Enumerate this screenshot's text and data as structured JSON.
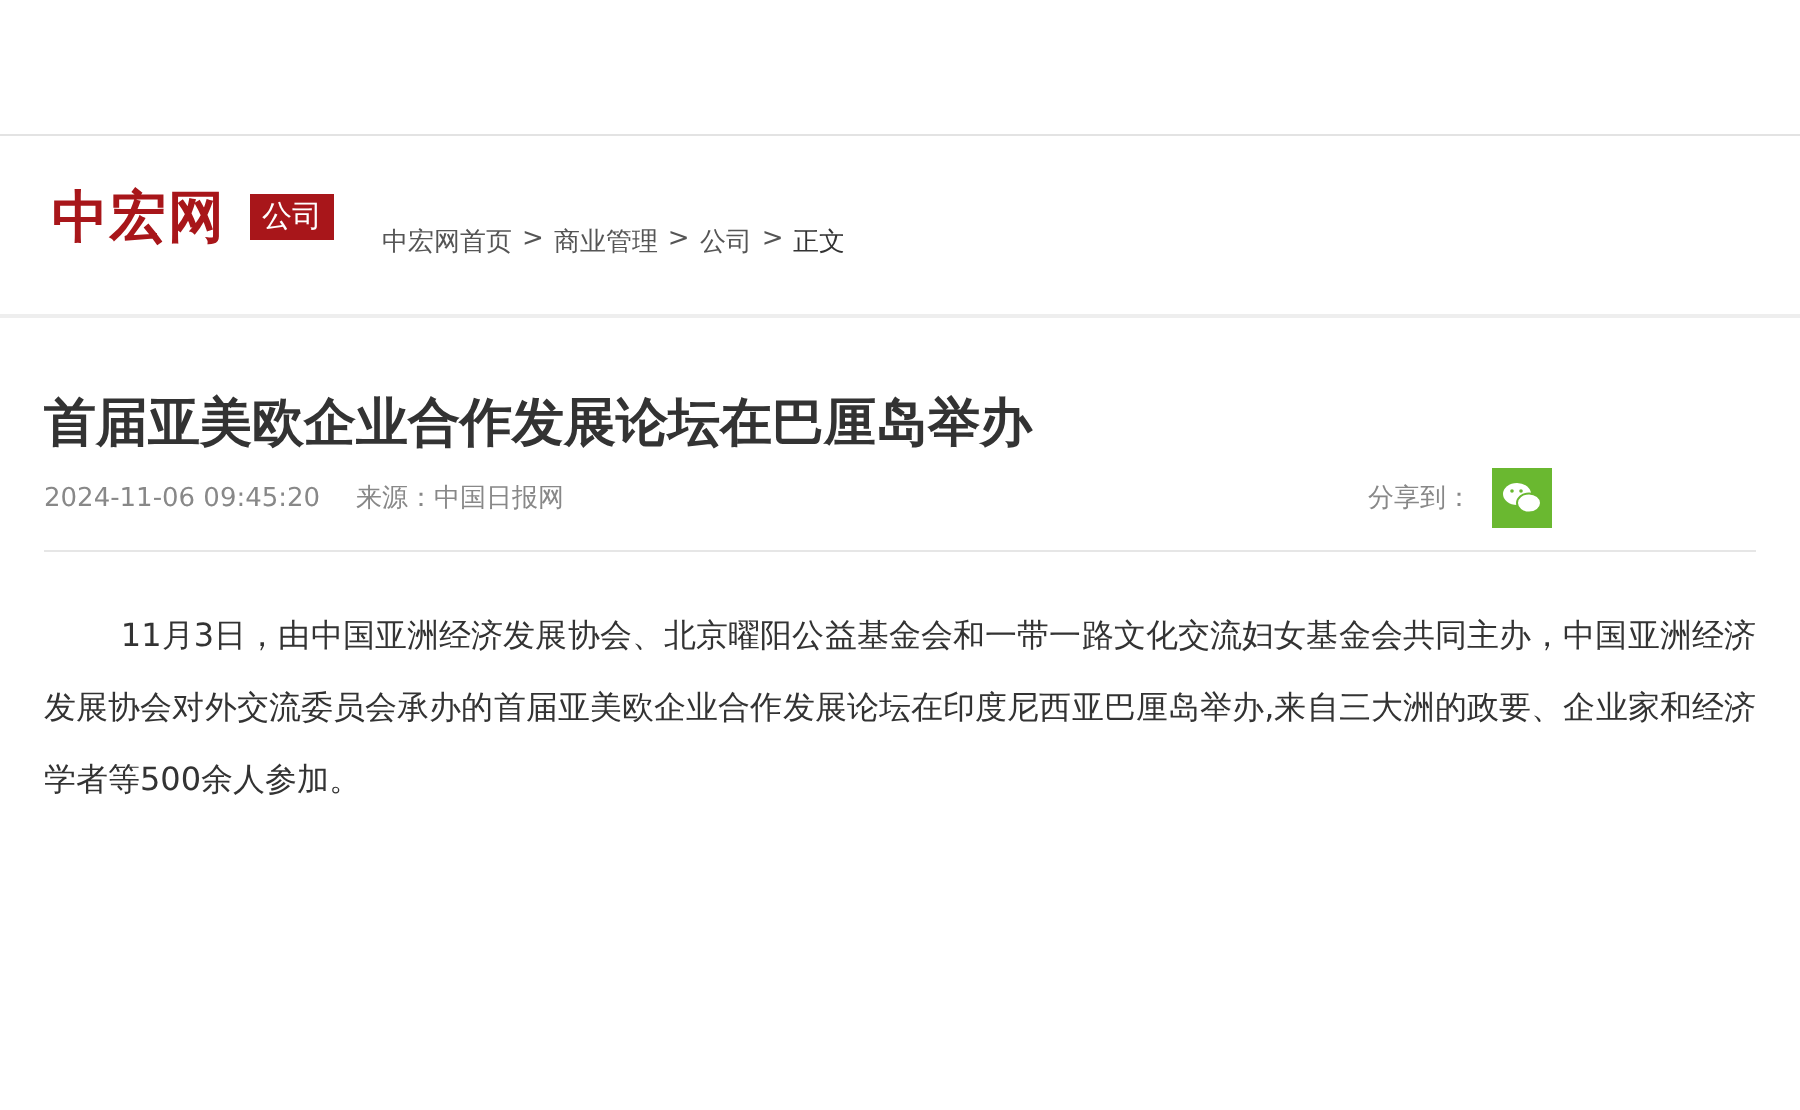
{
  "header": {
    "logo": "中宏网",
    "section_badge": "公司",
    "breadcrumb": [
      {
        "label": "中宏网首页",
        "separator": ">"
      },
      {
        "label": "商业管理",
        "separator": ">"
      },
      {
        "label": "公司",
        "separator": ">"
      },
      {
        "label": "正文"
      }
    ]
  },
  "article": {
    "title": "首届亚美欧企业合作发展论坛在巴厘岛举办",
    "date": "2024-11-06 09:45:20",
    "source": "来源：中国日报网",
    "share_label": "分享到：",
    "paragraph": "11月3日，由中国亚洲经济发展协会、北京曜阳公益基金会和一带一路文化交流妇女基金会共同主办，中国亚洲经济发展协会对外交流委员会承办的首届亚美欧企业合作发展论坛在印度尼西亚巴厘岛举办,来自三大洲的政要、企业家和经济学者等500余人参加。"
  }
}
